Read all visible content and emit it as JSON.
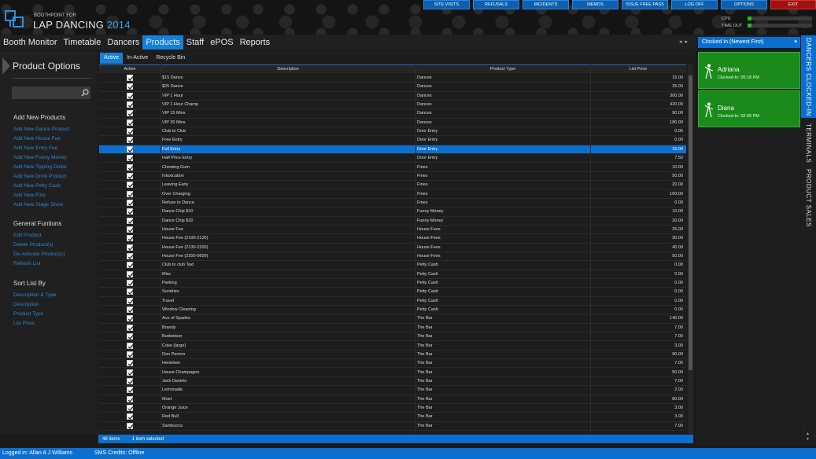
{
  "brand": {
    "sub": "BOOTHPOINT FOR",
    "main": "LAP DANCING",
    "year": "2014"
  },
  "top_buttons": [
    {
      "label": "SITE VISITS",
      "width": 58
    },
    {
      "label": "REFUSALS",
      "width": 58
    },
    {
      "label": "INCIDENTS",
      "width": 58
    },
    {
      "label": "MEMOS",
      "width": 58
    },
    {
      "label": "ISSUE FREE PASS",
      "width": 58
    },
    {
      "label": "LOG OFF",
      "width": 58
    },
    {
      "label": "OPTIONS",
      "width": 58
    },
    {
      "label": "EXIT",
      "width": 58
    }
  ],
  "meters": {
    "cpu_label": "CPU",
    "timeout_label": "TIME OUT"
  },
  "nav": [
    "Booth Monitor",
    "Timetable",
    "Dancers",
    "Products",
    "Staff",
    "ePOS",
    "Reports"
  ],
  "nav_active": "Products",
  "left": {
    "title": "Product Options",
    "search_placeholder": "",
    "sections": [
      {
        "title": "Add New Products",
        "links": [
          "Add New Dance Product",
          "Add New House Fee",
          "Add New Entry Fee",
          "Add New Funny Money",
          "Add New Tipping Dollar",
          "Add New Drink Product",
          "Add New Petty Cash",
          "Add New Fine",
          "Add New Stage Show"
        ]
      },
      {
        "title": "General Funtions",
        "links": [
          "Edit Product",
          "Delete Product(s)",
          "De-Activate Product(s)",
          "Refresh List"
        ]
      },
      {
        "title": "Sort List By",
        "links": [
          "Description & Type",
          "Description",
          "Product Type",
          "List Price"
        ]
      }
    ]
  },
  "subtabs": [
    "Active",
    "In-Active",
    "Recycle Bin"
  ],
  "grid": {
    "headers": [
      "Active",
      "Description",
      "Product Type",
      "List Price"
    ],
    "rows": [
      [
        "$15 Dance",
        "Dances",
        "15.00"
      ],
      [
        "$25 Dance",
        "Dances",
        "25.00"
      ],
      [
        "VIP 1 Hour",
        "Dances",
        "300.00"
      ],
      [
        "VIP 1 Hour Champ",
        "Dances",
        "420.00"
      ],
      [
        "VIP 15 Mins",
        "Dances",
        "90.00"
      ],
      [
        "VIP 30 Mins",
        "Dances",
        "180.00"
      ],
      [
        "Club to Club",
        "Door Entry",
        "0.00"
      ],
      [
        "Free Entry",
        "Door Entry",
        "0.00"
      ],
      [
        "Full Entry",
        "Door Entry",
        "15.00"
      ],
      [
        "Half Price Entry",
        "Door Entry",
        "7.50"
      ],
      [
        "Chewing Gum",
        "Fines",
        "10.00"
      ],
      [
        "Intoxication",
        "Fines",
        "50.00"
      ],
      [
        "Leaving Early",
        "Fines",
        "20.00"
      ],
      [
        "Over Charging",
        "Fines",
        "100.00"
      ],
      [
        "Refuse to Dance",
        "Fines",
        "0.00"
      ],
      [
        "Dance Chip $10",
        "Funny Money",
        "10.00"
      ],
      [
        "Dance Chip $20",
        "Funny Money",
        "20.00"
      ],
      [
        "House Fee",
        "House Fees",
        "25.00"
      ],
      [
        "House Fee (2100-2130)",
        "House Fees",
        "30.00"
      ],
      [
        "House Fee (2130-2200)",
        "House Fees",
        "40.00"
      ],
      [
        "House Fee (2200-0600)",
        "House Fees",
        "50.00"
      ],
      [
        "Club to club Taxi",
        "Petty Cash",
        "0.00"
      ],
      [
        "Misc",
        "Petty Cash",
        "0.00"
      ],
      [
        "Parking",
        "Petty Cash",
        "0.00"
      ],
      [
        "Sundries",
        "Petty Cash",
        "0.00"
      ],
      [
        "Travel",
        "Petty Cash",
        "0.00"
      ],
      [
        "Window Cleaning",
        "Petty Cash",
        "0.00"
      ],
      [
        "Ace of Spades",
        "The Bar",
        "140.00"
      ],
      [
        "Brandy",
        "The Bar",
        "7.00"
      ],
      [
        "Budweiser",
        "The Bar",
        "7.00"
      ],
      [
        "Coke (large)",
        "The Bar",
        "3.00"
      ],
      [
        "Don Perrion",
        "The Bar",
        "90.00"
      ],
      [
        "Henieken",
        "The Bar",
        "7.00"
      ],
      [
        "House Champagne",
        "The Bar",
        "50.00"
      ],
      [
        "Jack Daniels",
        "The Bar",
        "7.00"
      ],
      [
        "Lemonade",
        "The Bar",
        "2.00"
      ],
      [
        "Moet",
        "The Bar",
        "80.00"
      ],
      [
        "Orange Juice",
        "The Bar",
        "3.00"
      ],
      [
        "Red Bull",
        "The Bar",
        "3.00"
      ],
      [
        "Sambucca",
        "The Bar",
        "7.00"
      ]
    ],
    "selected_row": 8
  },
  "status": {
    "items": "48 items",
    "selected": "1 item selected"
  },
  "right": {
    "select_label": "Clocked In (Newest First)",
    "dancers": [
      {
        "name": "Adriana",
        "time": "Clocked-In: 05:18 PM"
      },
      {
        "name": "Diana",
        "time": "Clocked-In: 02:09 PM"
      }
    ]
  },
  "side_tabs": [
    "DANCERS CLOCKED-IN",
    "TERMINALS",
    "PRODUCT SALES"
  ],
  "footer": {
    "logged_in": "Logged in: Allan A J Williams",
    "sms": "SMS Credits: Offline"
  },
  "colors": {
    "accent": "#0b6fd0",
    "green": "#1a8a1a",
    "exit": "#a31010"
  }
}
